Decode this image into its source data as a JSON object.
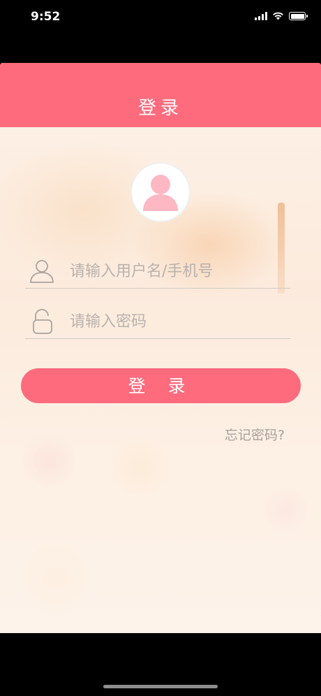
{
  "status_bar": {
    "time": "9:52",
    "icons": [
      "signal-icon",
      "wifi-icon",
      "battery-icon"
    ]
  },
  "nav": {
    "title": "登录"
  },
  "form": {
    "username_placeholder": "请输入用户名/手机号",
    "password_placeholder": "请输入密码",
    "login_button_label": "登 录",
    "forgot_password_label": "忘记密码?"
  },
  "icons": {
    "avatar": "user-avatar-icon",
    "username": "user-outline-icon",
    "password": "lock-outline-icon"
  },
  "colors": {
    "accent": "#fe6b7d",
    "avatar_fill": "#fdb8c4",
    "placeholder_text": "#b9b2ad",
    "link_text": "#a8a19c"
  }
}
